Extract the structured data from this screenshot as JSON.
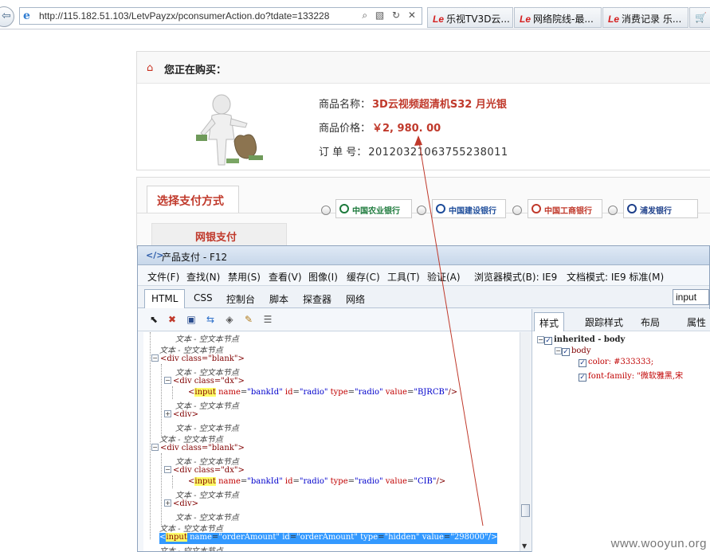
{
  "browser": {
    "address": "http://115.182.51.103/LetvPayzx/pconsumerAction.do?tdate=133228",
    "address_tools": "⌕ ▧ ↻ ✕",
    "tabs": [
      {
        "icon": "letv-logo",
        "label": "乐视TV3D云..."
      },
      {
        "icon": "letv-logo",
        "label": "网络院线-最..."
      },
      {
        "icon": "letv-logo",
        "label": "消费记录 乐..."
      }
    ]
  },
  "purchase": {
    "heading": "您正在购买：",
    "name_label": "商品名称：",
    "name_value": "3D云视频超清机S32 月光银",
    "price_label": "商品价格：",
    "price_value": "￥2, 980. 00",
    "order_label": "订 单 号：",
    "order_value": "20120321063755238011"
  },
  "payment": {
    "tab_label": "选择支付方式",
    "side_label": "网银支付",
    "banks": [
      "中国农业银行",
      "中国建设银行",
      "中国工商银行",
      "浦发银行"
    ],
    "bank_colors": [
      "#1d7a3c",
      "#1d4c9a",
      "#c0392b",
      "#1d3f8a"
    ]
  },
  "devtools": {
    "title": "产品支付 - F12",
    "menu": [
      "文件(F)",
      "查找(N)",
      "禁用(S)",
      "查看(V)",
      "图像(I)",
      "缓存(C)",
      "工具(T)",
      "验证(A)",
      "浏览器模式(B): IE9",
      "文档模式: IE9 标准(M)"
    ],
    "tabs": [
      "HTML",
      "CSS",
      "控制台",
      "脚本",
      "探查器",
      "网络"
    ],
    "search_value": "input",
    "style_tabs": [
      "样式",
      "跟踪样式",
      "布局",
      "属性"
    ],
    "text_node": "文本 - 空文本节点",
    "div_blank": "<div class=\"blank\">",
    "div_dx": "<div class=\"dx\">",
    "div_tag": "<div>",
    "input_tag": "input",
    "lt": "<",
    "bank_input_1_attrs": [
      [
        "name",
        "\"bankId\""
      ],
      [
        "id",
        "\"radio\""
      ],
      [
        "type",
        "\"radio\""
      ],
      [
        "value",
        "\"BJRCB\""
      ]
    ],
    "bank_input_2_attrs": [
      [
        "name",
        "\"bankId\""
      ],
      [
        "id",
        "\"radio\""
      ],
      [
        "type",
        "\"radio\""
      ],
      [
        "value",
        "\"CIB\""
      ]
    ],
    "order_input_attrs": [
      [
        "name",
        "\"orderAmount\""
      ],
      [
        "id",
        "\"orderAmount\""
      ],
      [
        "type",
        "\"hidden\""
      ],
      [
        "value",
        "\"298000\""
      ]
    ],
    "close_tag": "/>",
    "styles": {
      "inherited": "inherited - body",
      "selector": "body",
      "color_prop": "color: #333333;",
      "font_prop": "font-family: \"微软雅黑,宋"
    }
  },
  "watermark": "www.wooyun.org"
}
